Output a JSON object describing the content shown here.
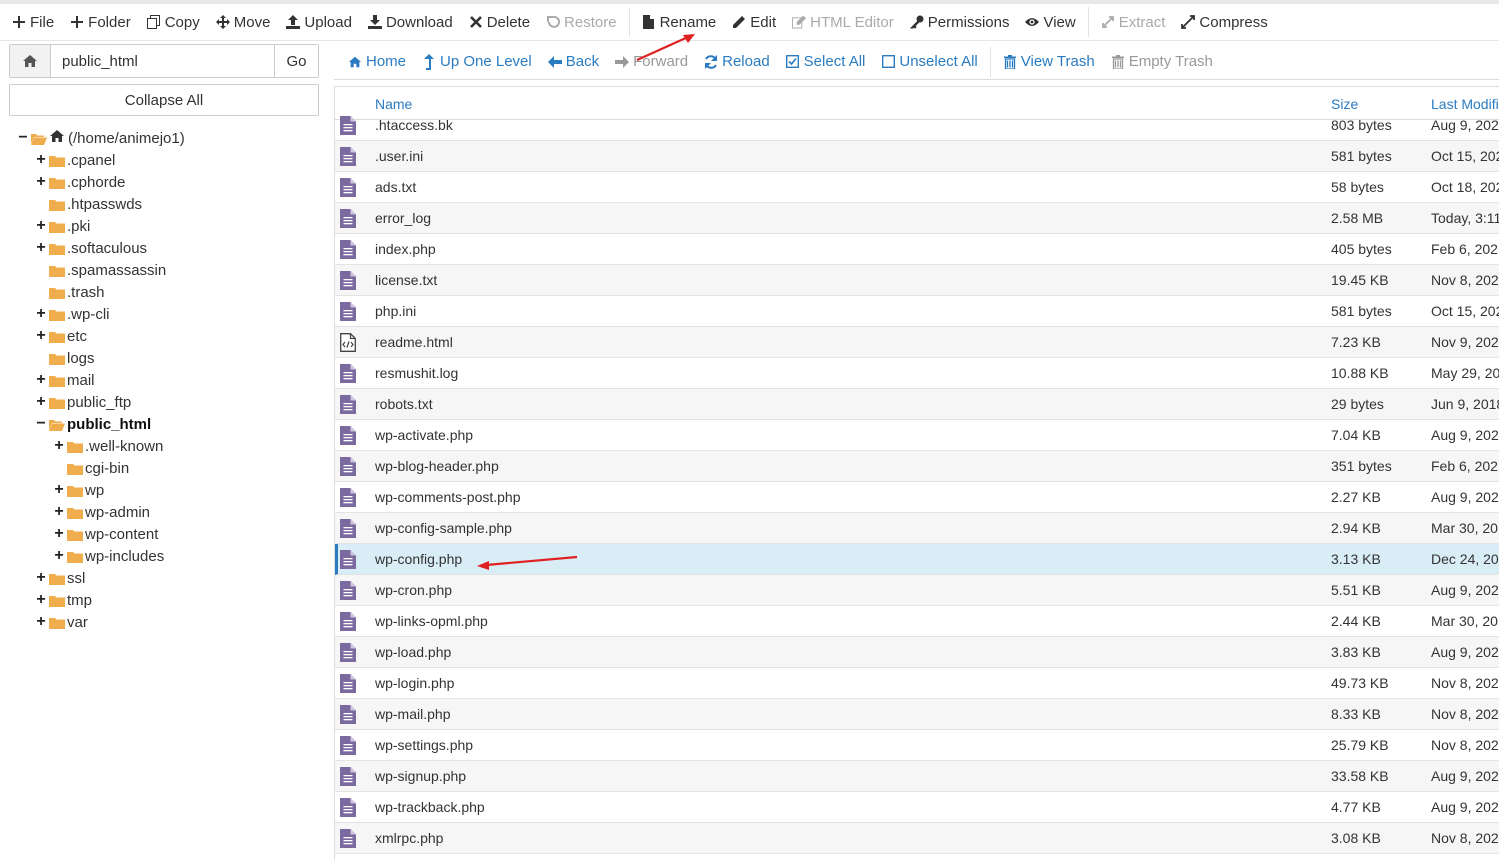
{
  "toolbar": {
    "items": [
      {
        "label": "File",
        "icon": "plus-icon",
        "enabled": true
      },
      {
        "label": "Folder",
        "icon": "plus-icon",
        "enabled": true
      },
      {
        "label": "Copy",
        "icon": "copy-icon",
        "enabled": true
      },
      {
        "label": "Move",
        "icon": "move-icon",
        "enabled": true
      },
      {
        "label": "Upload",
        "icon": "upload-icon",
        "enabled": true
      },
      {
        "label": "Download",
        "icon": "download-icon",
        "enabled": true
      },
      {
        "label": "Delete",
        "icon": "close-icon",
        "enabled": true
      },
      {
        "label": "Restore",
        "icon": "undo-icon",
        "enabled": false
      },
      {
        "label": "Rename",
        "icon": "file-icon",
        "enabled": true
      },
      {
        "label": "Edit",
        "icon": "pencil-icon",
        "enabled": true
      },
      {
        "label": "HTML Editor",
        "icon": "edit-icon",
        "enabled": false
      },
      {
        "label": "Permissions",
        "icon": "key-icon",
        "enabled": true
      },
      {
        "label": "View",
        "icon": "eye-icon",
        "enabled": true
      },
      {
        "label": "Extract",
        "icon": "expand-icon",
        "enabled": false
      },
      {
        "label": "Compress",
        "icon": "compress-icon",
        "enabled": true
      }
    ]
  },
  "path_bar": {
    "value": "public_html",
    "go_label": "Go"
  },
  "collapse_label": "Collapse All",
  "tree": [
    {
      "label": "(/home/animejo1)",
      "level": 0,
      "expander": "−",
      "home": true,
      "open": true
    },
    {
      "label": ".cpanel",
      "level": 1,
      "expander": "+"
    },
    {
      "label": ".cphorde",
      "level": 1,
      "expander": "+"
    },
    {
      "label": ".htpasswds",
      "level": 1,
      "expander": ""
    },
    {
      "label": ".pki",
      "level": 1,
      "expander": "+"
    },
    {
      "label": ".softaculous",
      "level": 1,
      "expander": "+"
    },
    {
      "label": ".spamassassin",
      "level": 1,
      "expander": ""
    },
    {
      "label": ".trash",
      "level": 1,
      "expander": ""
    },
    {
      "label": ".wp-cli",
      "level": 1,
      "expander": "+"
    },
    {
      "label": "etc",
      "level": 1,
      "expander": "+"
    },
    {
      "label": "logs",
      "level": 1,
      "expander": ""
    },
    {
      "label": "mail",
      "level": 1,
      "expander": "+"
    },
    {
      "label": "public_ftp",
      "level": 1,
      "expander": "+"
    },
    {
      "label": "public_html",
      "level": 1,
      "expander": "−",
      "bold": true,
      "open": true
    },
    {
      "label": ".well-known",
      "level": 2,
      "expander": "+"
    },
    {
      "label": "cgi-bin",
      "level": 2,
      "expander": ""
    },
    {
      "label": "wp",
      "level": 2,
      "expander": "+"
    },
    {
      "label": "wp-admin",
      "level": 2,
      "expander": "+"
    },
    {
      "label": "wp-content",
      "level": 2,
      "expander": "+"
    },
    {
      "label": "wp-includes",
      "level": 2,
      "expander": "+"
    },
    {
      "label": "ssl",
      "level": 1,
      "expander": "+"
    },
    {
      "label": "tmp",
      "level": 1,
      "expander": "+"
    },
    {
      "label": "var",
      "level": 1,
      "expander": "+"
    }
  ],
  "subbar": {
    "items": [
      {
        "label": "Home",
        "icon": "home-icon",
        "enabled": true
      },
      {
        "label": "Up One Level",
        "icon": "level-up-icon",
        "enabled": true
      },
      {
        "label": "Back",
        "icon": "arrow-left-icon",
        "enabled": true
      },
      {
        "label": "Forward",
        "icon": "arrow-right-icon",
        "enabled": false
      },
      {
        "label": "Reload",
        "icon": "refresh-icon",
        "enabled": true
      },
      {
        "label": "Select All",
        "icon": "check-square-icon",
        "enabled": true
      },
      {
        "label": "Unselect All",
        "icon": "square-icon",
        "enabled": true
      },
      {
        "label": "View Trash",
        "icon": "trash-icon",
        "enabled": true
      },
      {
        "label": "Empty Trash",
        "icon": "trash-icon",
        "enabled": false
      }
    ]
  },
  "table": {
    "columns": {
      "name": "Name",
      "size": "Size",
      "modified": "Last Modifi"
    },
    "rows": [
      {
        "name": ".htaccess.bk",
        "size": "803 bytes",
        "modified": "Aug 9, 202",
        "type": "text"
      },
      {
        "name": ".user.ini",
        "size": "581 bytes",
        "modified": "Oct 15, 202",
        "type": "text"
      },
      {
        "name": "ads.txt",
        "size": "58 bytes",
        "modified": "Oct 18, 202",
        "type": "text"
      },
      {
        "name": "error_log",
        "size": "2.58 MB",
        "modified": "Today, 3:11",
        "type": "text"
      },
      {
        "name": "index.php",
        "size": "405 bytes",
        "modified": "Feb 6, 202",
        "type": "text"
      },
      {
        "name": "license.txt",
        "size": "19.45 KB",
        "modified": "Nov 8, 202",
        "type": "text"
      },
      {
        "name": "php.ini",
        "size": "581 bytes",
        "modified": "Oct 15, 202",
        "type": "text"
      },
      {
        "name": "readme.html",
        "size": "7.23 KB",
        "modified": "Nov 9, 202",
        "type": "html"
      },
      {
        "name": "resmushit.log",
        "size": "10.88 KB",
        "modified": "May 29, 20",
        "type": "text"
      },
      {
        "name": "robots.txt",
        "size": "29 bytes",
        "modified": "Jun 9, 2018",
        "type": "text"
      },
      {
        "name": "wp-activate.php",
        "size": "7.04 KB",
        "modified": "Aug 9, 202",
        "type": "text"
      },
      {
        "name": "wp-blog-header.php",
        "size": "351 bytes",
        "modified": "Feb 6, 202",
        "type": "text"
      },
      {
        "name": "wp-comments-post.php",
        "size": "2.27 KB",
        "modified": "Aug 9, 202",
        "type": "text"
      },
      {
        "name": "wp-config-sample.php",
        "size": "2.94 KB",
        "modified": "Mar 30, 20",
        "type": "text"
      },
      {
        "name": "wp-config.php",
        "size": "3.13 KB",
        "modified": "Dec 24, 20",
        "type": "text",
        "selected": true
      },
      {
        "name": "wp-cron.php",
        "size": "5.51 KB",
        "modified": "Aug 9, 202",
        "type": "text"
      },
      {
        "name": "wp-links-opml.php",
        "size": "2.44 KB",
        "modified": "Mar 30, 20",
        "type": "text"
      },
      {
        "name": "wp-load.php",
        "size": "3.83 KB",
        "modified": "Aug 9, 202",
        "type": "text"
      },
      {
        "name": "wp-login.php",
        "size": "49.73 KB",
        "modified": "Nov 8, 202",
        "type": "text"
      },
      {
        "name": "wp-mail.php",
        "size": "8.33 KB",
        "modified": "Nov 8, 202",
        "type": "text"
      },
      {
        "name": "wp-settings.php",
        "size": "25.79 KB",
        "modified": "Nov 8, 202",
        "type": "text"
      },
      {
        "name": "wp-signup.php",
        "size": "33.58 KB",
        "modified": "Aug 9, 202",
        "type": "text"
      },
      {
        "name": "wp-trackback.php",
        "size": "4.77 KB",
        "modified": "Aug 9, 202",
        "type": "text"
      },
      {
        "name": "xmlrpc.php",
        "size": "3.08 KB",
        "modified": "Nov 8, 202",
        "type": "text"
      }
    ]
  },
  "colors": {
    "accent": "#2b7bc1",
    "folder": "#f0ad4e",
    "file_icon": "#7b6aa0",
    "selected_row": "#d9edf7",
    "annotation_arrow": "#e02020"
  }
}
